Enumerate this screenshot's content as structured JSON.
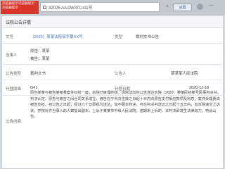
{
  "browser": {
    "badge_text": "浏览器提示浏览器提示浏览器提示",
    "address": "32025 AA/2W3TLI/11号",
    "close_symbol": "×",
    "action_button": "设置",
    "menu_symbol": "⋯"
  },
  "panel": {
    "title": "法院公告详情"
  },
  "fields": {
    "row1": {
      "label": "文号",
      "value": "（2020）某某法院某字第XX号",
      "label2": "类型",
      "value2": "裁判文书公告"
    },
    "row2": {
      "label": "当事人",
      "value1": "原告：某某",
      "value2": "被告：某某"
    },
    "row3": {
      "label": "公告类型",
      "value": "裁判文书",
      "label2": "公告人",
      "value2": "某某某人民法院"
    },
    "row4": {
      "label": "刊登版面",
      "value": "G41",
      "label2": "刊登日期",
      "value2": "2020-12-18"
    }
  },
  "abstract": {
    "label": "公告内容",
    "text": "原告某某与被告某某某案件纠纷一案，本院已审理终结。现依法向你公告送达本院（2020）某某民初某号民事判决书。判决认定，原告与被告之间合同关系成立，被告应于判决生效之日起十日内向原告支付相应款项及利息，案件受理费由被告负担。自公告之日起，经过六十日即视为送达。如不服本判决，可在判决书送达之日起十五日内，向本院递交上诉状，并按对方当事人的人数提出副本，上诉于某某市中级人民法院。逾期未上诉的，本判决即发生法律效力。特此公告。"
  }
}
